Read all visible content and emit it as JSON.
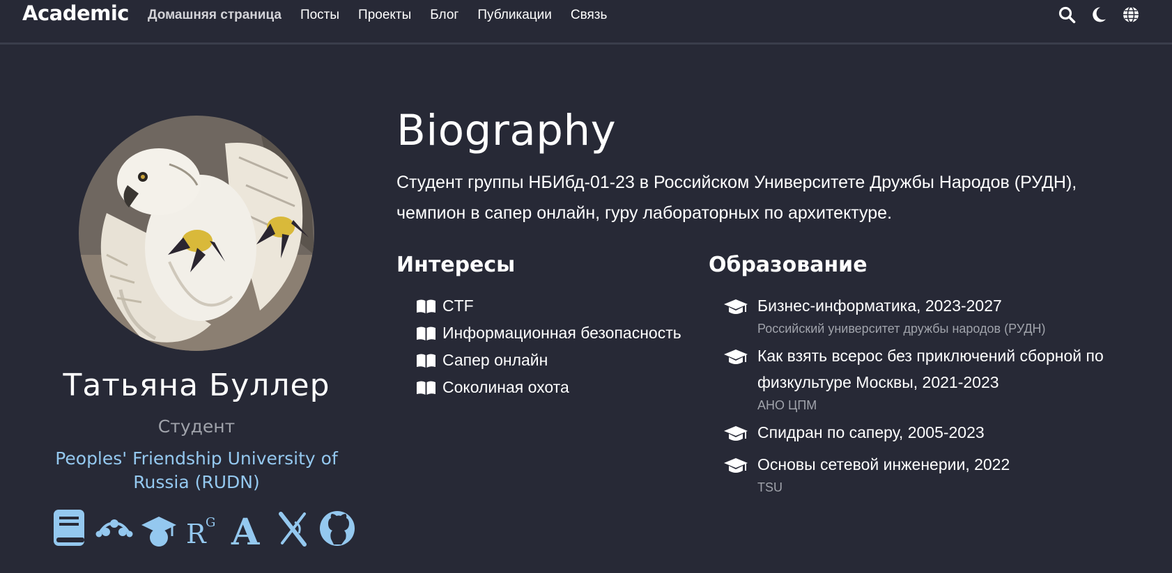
{
  "navbar": {
    "brand": "Academic",
    "links": [
      {
        "label": "Домашняя страница",
        "active": true
      },
      {
        "label": "Посты"
      },
      {
        "label": "Проекты"
      },
      {
        "label": "Блог"
      },
      {
        "label": "Публикации"
      },
      {
        "label": "Связь"
      }
    ],
    "icons": [
      "search-icon",
      "moon-icon",
      "globe-icon"
    ]
  },
  "profile": {
    "avatar": "falcon-portrait",
    "name": "Татьяна Буллер",
    "role": "Студент",
    "organization": "Peoples' Friendship University of Russia (RUDN)",
    "social_icons": [
      "book-icon",
      "mendeley-icon",
      "graduation-cap-icon",
      "researchgate-icon",
      "academia-icon",
      "orcid-icon",
      "github-icon"
    ]
  },
  "biography": {
    "title": "Biography",
    "text": "Студент группы НБИбд-01-23 в Российском Университете Дружбы Народов (РУДН), чемпион в сапер онлайн, гуру лабораторных по архитектуре."
  },
  "interests": {
    "title": "Интересы",
    "items": [
      "CTF",
      "Информационная безопасность",
      "Сапер онлайн",
      "Соколиная охота"
    ]
  },
  "education": {
    "title": "Образование",
    "items": [
      {
        "course": "Бизнес-информатика, 2023-2027",
        "institution": "Российский университет дружбы народов (РУДН)"
      },
      {
        "course": "Как взять всерос без приключений сборной по физкультуре Москвы, 2021-2023",
        "institution": "АНО ЦПМ"
      },
      {
        "course": "Спидран по саперу, 2005-2023",
        "institution": ""
      },
      {
        "course": "Основы сетевой инженерии, 2022",
        "institution": "TSU"
      }
    ]
  },
  "colors": {
    "background": "#272936",
    "accent": "#94c8ef",
    "muted": "#a0a3ab"
  }
}
